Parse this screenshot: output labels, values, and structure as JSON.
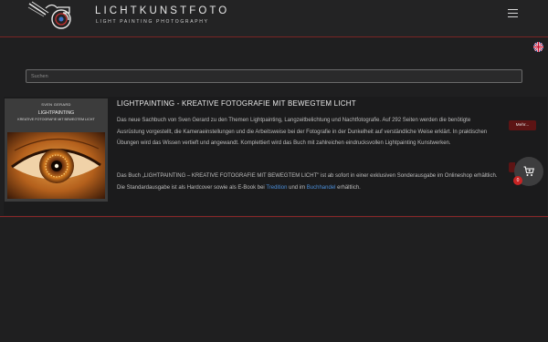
{
  "header": {
    "brand_name": "LICHTKUNSTFOTO",
    "brand_tagline": "LIGHT PAINTING PHOTOGRAPHY"
  },
  "search": {
    "placeholder": "Suchen"
  },
  "product": {
    "cover": {
      "author": "SVEN GERARD",
      "title": "LIGHTPAINTING",
      "subtitle": "KREATIVE FOTOGRAFIE MIT BEWEGTEM LICHT"
    },
    "title": "LIGHTPAINTING - KREATIVE FOTOGRAFIE MIT BEWEGTEM LICHT",
    "description": "Das neue Sachbuch von Sven Gerard zu den Themen Lightpainting, Langzeitbelichtung und Nachtfotografie. Auf 292 Seiten werden die benötigte Ausrüstung vorgestellt, die Kameraeinstellungen und die Arbeitsweise bei der Fotografie in der Dunkelheit auf verständliche Weise erklärt. In praktischen Übungen wird das Wissen vertieft und angewandt. Komplettiert wird das Buch mit zahlreichen eindrucksvollen Lightpainting Kunstwerken.",
    "availability_part1": "Das Buch „LIGHTPAINTING – KREATIVE FOTOGRAFIE MIT BEWEGTEM LICHT\" ist ab sofort in einer exklusiven Sonderausgabe im Onlineshop erhältlich. Die Standardausgabe ist als Hardcover sowie als E-Book bei ",
    "link_tredition": "Tredition",
    "availability_part2": " und im ",
    "link_buchhandel": "Buchhandel",
    "availability_part3": " erhältlich.",
    "more_button": "Mehr..."
  },
  "cart": {
    "count": "0"
  },
  "icons": {
    "menu": "hamburger-menu-icon",
    "language": "uk-flag-icon",
    "cart": "shopping-cart-icon"
  },
  "colors": {
    "background": "#1f1f20",
    "accent_red": "#8a2828",
    "button_red": "#5d1414",
    "link_blue": "#4b8ed8",
    "badge_red": "#c82424"
  }
}
